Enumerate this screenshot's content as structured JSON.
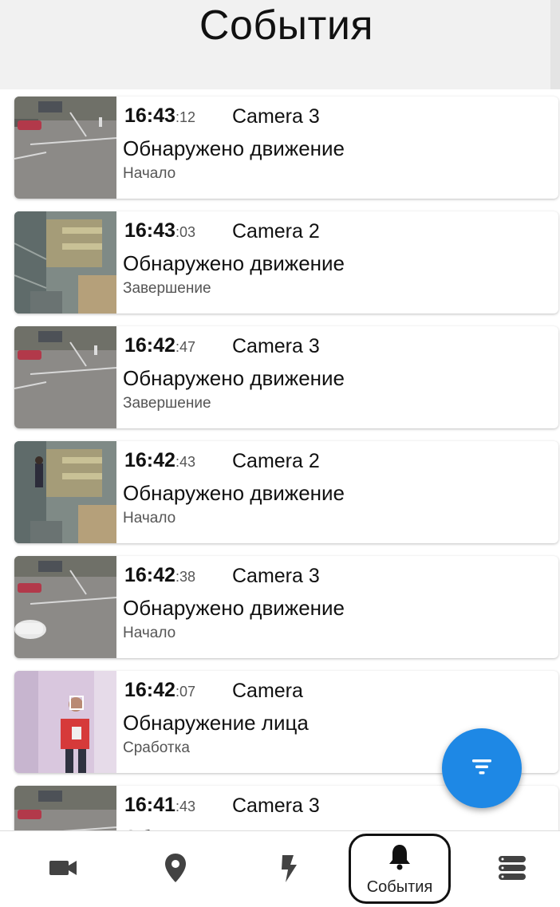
{
  "header": {
    "title": "События"
  },
  "events": [
    {
      "time_hm": "16:43",
      "time_sec": ":12",
      "camera": "Camera 3",
      "type": "Обнаружено движение",
      "state": "Начало",
      "thumb": "parking-lot"
    },
    {
      "time_hm": "16:43",
      "time_sec": ":03",
      "camera": "Camera 2",
      "type": "Обнаружено движение",
      "state": "Завершение",
      "thumb": "warehouse"
    },
    {
      "time_hm": "16:42",
      "time_sec": ":47",
      "camera": "Camera 3",
      "type": "Обнаружено движение",
      "state": "Завершение",
      "thumb": "parking-lot"
    },
    {
      "time_hm": "16:42",
      "time_sec": ":43",
      "camera": "Camera 2",
      "type": "Обнаружено движение",
      "state": "Начало",
      "thumb": "warehouse"
    },
    {
      "time_hm": "16:42",
      "time_sec": ":38",
      "camera": "Camera 3",
      "type": "Обнаружено движение",
      "state": "Начало",
      "thumb": "parking-lot-car"
    },
    {
      "time_hm": "16:42",
      "time_sec": ":07",
      "camera": "Camera",
      "type": "Обнаружение лица",
      "state": "Сработка",
      "thumb": "corridor-face"
    },
    {
      "time_hm": "16:41",
      "time_sec": ":43",
      "camera": "Camera 3",
      "type": "Обнаружено движение",
      "state": "",
      "thumb": "parking-lot"
    }
  ],
  "fab": {
    "icon": "filter-icon",
    "color": "#1e88e5"
  },
  "bottom_nav": {
    "items": [
      {
        "icon": "video-camera-icon"
      },
      {
        "icon": "location-pin-icon"
      },
      {
        "icon": "lightning-icon"
      },
      {
        "icon": "bell-icon",
        "label": "События",
        "active": true
      },
      {
        "icon": "server-list-icon"
      }
    ]
  }
}
